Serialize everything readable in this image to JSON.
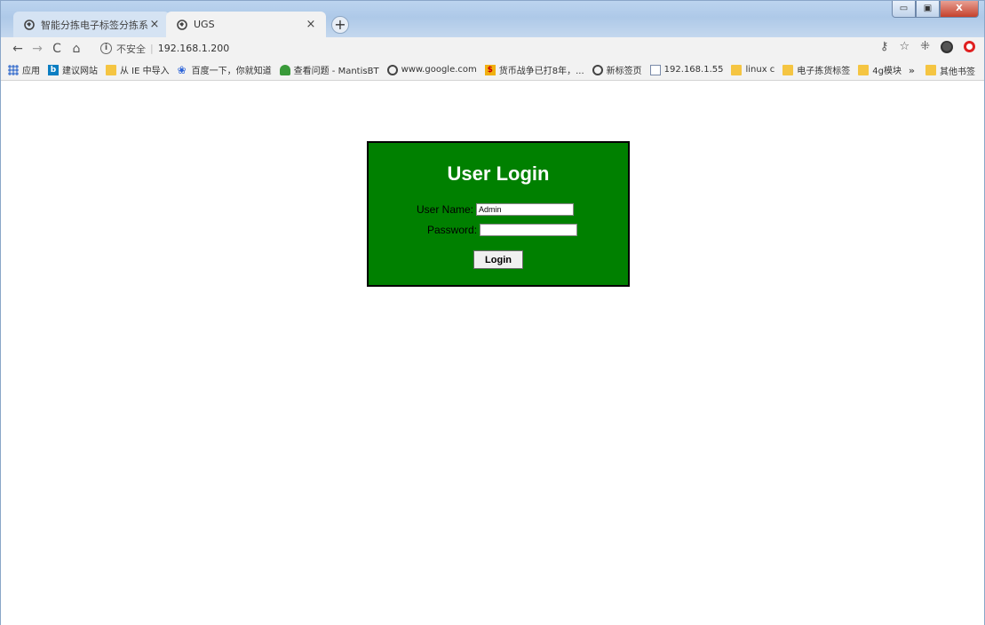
{
  "browser": {
    "tabs": [
      {
        "label": "智能分拣电子标签分拣系统",
        "active": false
      },
      {
        "label": "UGS",
        "active": true
      }
    ],
    "new_tab_label": "+",
    "window_controls": {
      "minimize": "▭",
      "maximize": "▣",
      "close": "X"
    },
    "nav": {
      "back": "←",
      "forward": "→",
      "reload": "C",
      "home": "⌂"
    },
    "address": {
      "security_label": "不安全",
      "url": "192.168.1.200"
    },
    "bookmarks": [
      {
        "label": "应用",
        "icon": "apps-icon"
      },
      {
        "label": "建议网站",
        "icon": "bing-icon"
      },
      {
        "label": "从 IE 中导入",
        "icon": "folder-icon"
      },
      {
        "label": "百度一下，你就知道",
        "icon": "baidu-icon"
      },
      {
        "label": "查看问题 - MantisBT",
        "icon": "mantis-icon"
      },
      {
        "label": "www.google.com",
        "icon": "globe-icon"
      },
      {
        "label": "货币战争已打8年，...",
        "icon": "coin-icon"
      },
      {
        "label": "新标签页",
        "icon": "globe-icon"
      },
      {
        "label": "192.168.1.55",
        "icon": "chart-icon"
      },
      {
        "label": "linux c",
        "icon": "folder-icon"
      },
      {
        "label": "电子拣货标签",
        "icon": "folder-icon"
      },
      {
        "label": "4g模块",
        "icon": "folder-icon"
      }
    ],
    "bookmarks_more": "»",
    "other_bookmarks": "其他书签"
  },
  "login": {
    "title": "User Login",
    "username_label": "User Name:",
    "username_value": "Admin",
    "password_label": "Password:",
    "password_value": "",
    "submit_label": "Login",
    "colors": {
      "panel": "#008000",
      "border": "#000000",
      "title": "#ffffff"
    }
  }
}
